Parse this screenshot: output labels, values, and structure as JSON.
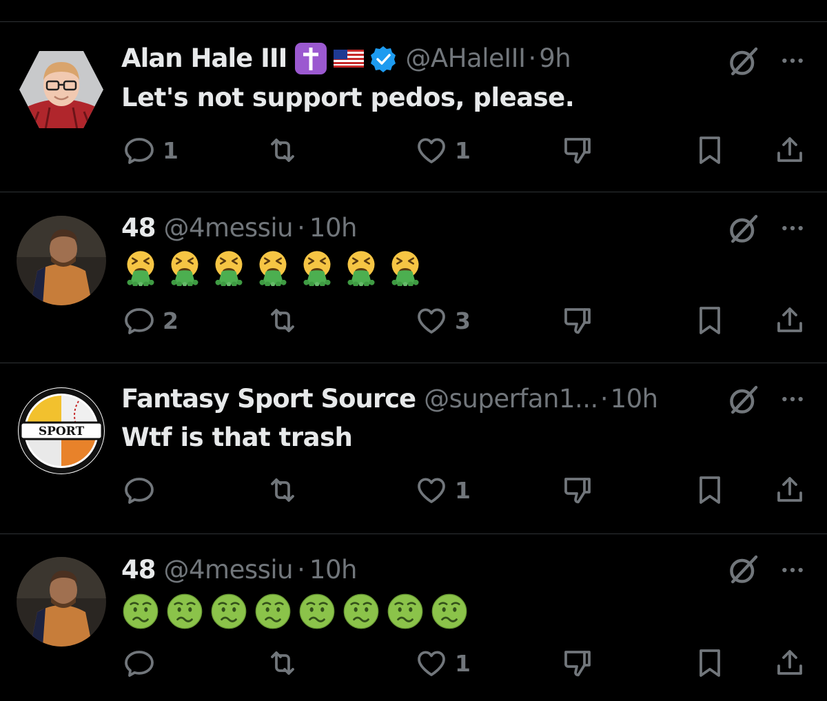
{
  "posts": [
    {
      "display_name": "Alan Hale III",
      "badges": [
        "cross-emoji",
        "us-flag-emoji",
        "verified-badge"
      ],
      "handle": "@AHaleIII",
      "separator": "·",
      "time": "9h",
      "text": "Let's not support pedos, please.",
      "replies": "1",
      "reposts": "",
      "likes": "1"
    },
    {
      "display_name": "48",
      "handle": "@4messiu",
      "separator": "·",
      "time": "10h",
      "emojis": [
        "vomiting-face",
        "vomiting-face",
        "vomiting-face",
        "vomiting-face",
        "vomiting-face",
        "vomiting-face",
        "vomiting-face"
      ],
      "replies": "2",
      "reposts": "",
      "likes": "3"
    },
    {
      "display_name": "Fantasy Sport Source",
      "handle": "@superfan1...",
      "separator": "·",
      "time": "10h",
      "text": "Wtf is that trash",
      "avatar_label": "SPORT",
      "replies": "",
      "reposts": "",
      "likes": "1"
    },
    {
      "display_name": "48",
      "handle": "@4messiu",
      "separator": "·",
      "time": "10h",
      "emojis": [
        "nauseated-face",
        "nauseated-face",
        "nauseated-face",
        "nauseated-face",
        "nauseated-face",
        "nauseated-face",
        "nauseated-face",
        "nauseated-face"
      ],
      "replies": "",
      "reposts": "",
      "likes": "1"
    }
  ],
  "colors": {
    "background": "#000000",
    "text_primary": "#e7e9ea",
    "text_secondary": "#71767b",
    "divider": "#2f3336",
    "verified_blue": "#1d9bf0",
    "cross_purple": "#9b59d0"
  }
}
